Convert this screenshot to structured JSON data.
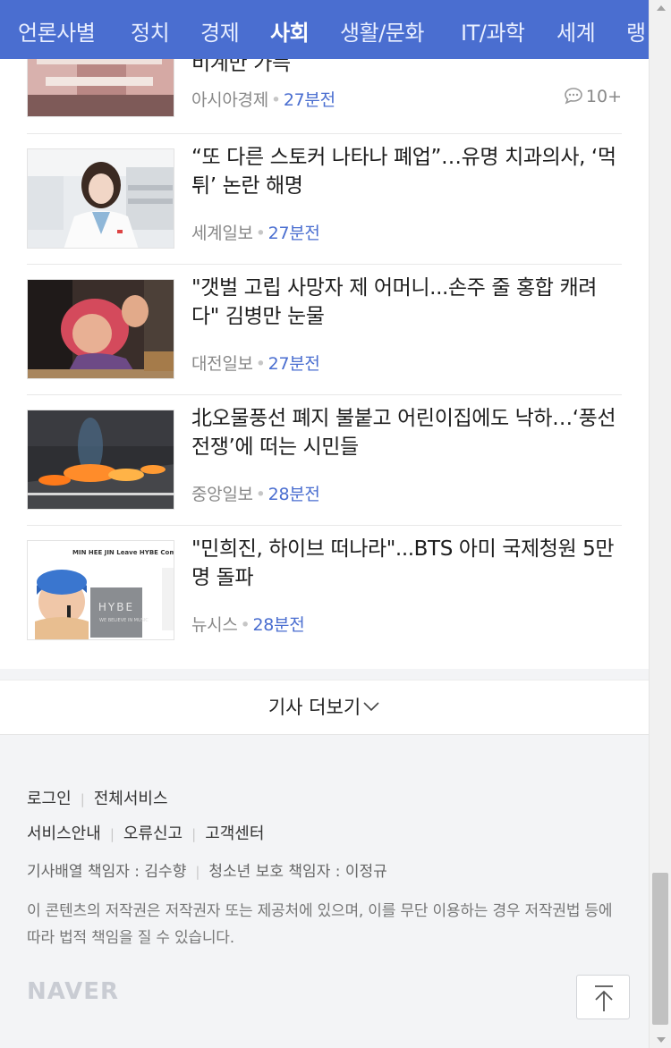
{
  "nav": {
    "tabs": [
      {
        "label": "언론사별"
      },
      {
        "label": "정치"
      },
      {
        "label": "경제"
      },
      {
        "label": "사회",
        "active": true
      },
      {
        "label": "생활/문화"
      },
      {
        "label": "IT/과학"
      },
      {
        "label": "세계"
      },
      {
        "label": "랭"
      }
    ]
  },
  "articles": [
    {
      "title": "비계만 가득",
      "source": "아시아경제",
      "time": "27분전",
      "comments": "10+"
    },
    {
      "title": "“또 다른 스토커 나타나 폐업”…유명 치과의사, ‘먹튀’ 논란 해명",
      "source": "세계일보",
      "time": "27분전"
    },
    {
      "title": "\"갯벌 고립 사망자 제 어머니...손주 줄 홍합 캐려다\" 김병만 눈물",
      "source": "대전일보",
      "time": "27분전"
    },
    {
      "title": "北오물풍선 폐지 불붙고 어린이집에도 낙하…‘풍선전쟁’에 떠는 시민들",
      "source": "중앙일보",
      "time": "28분전"
    },
    {
      "title": "\"민희진, 하이브 떠나라\"...BTS 아미 국제청원 5만명 돌파",
      "source": "뉴시스",
      "time": "28분전",
      "thumb_text": {
        "headline": "MIN HEE JIN Leave HYBE Comp",
        "brand": "HYBE",
        "slogan": "WE BELIEVE IN MUSIC"
      }
    }
  ],
  "more_label": "기사 더보기",
  "footer": {
    "row1": [
      "로그인",
      "전체서비스"
    ],
    "row2": [
      "서비스안내",
      "오류신고",
      "고객센터"
    ],
    "row3": [
      "기사배열 책임자 : 김수향",
      "청소년 보호 책임자 : 이정규"
    ],
    "copyright": "이 콘텐츠의 저작권은 저작권자 또는 제공처에 있으며, 이를 무단 이용하는 경우 저작권법 등에 따라 법적 책임을 질 수 있습니다.",
    "logo": "NAVER"
  },
  "colors": {
    "accent": "#4a6ed0",
    "time": "#4a6ed0",
    "bg": "#f3f4f6"
  }
}
